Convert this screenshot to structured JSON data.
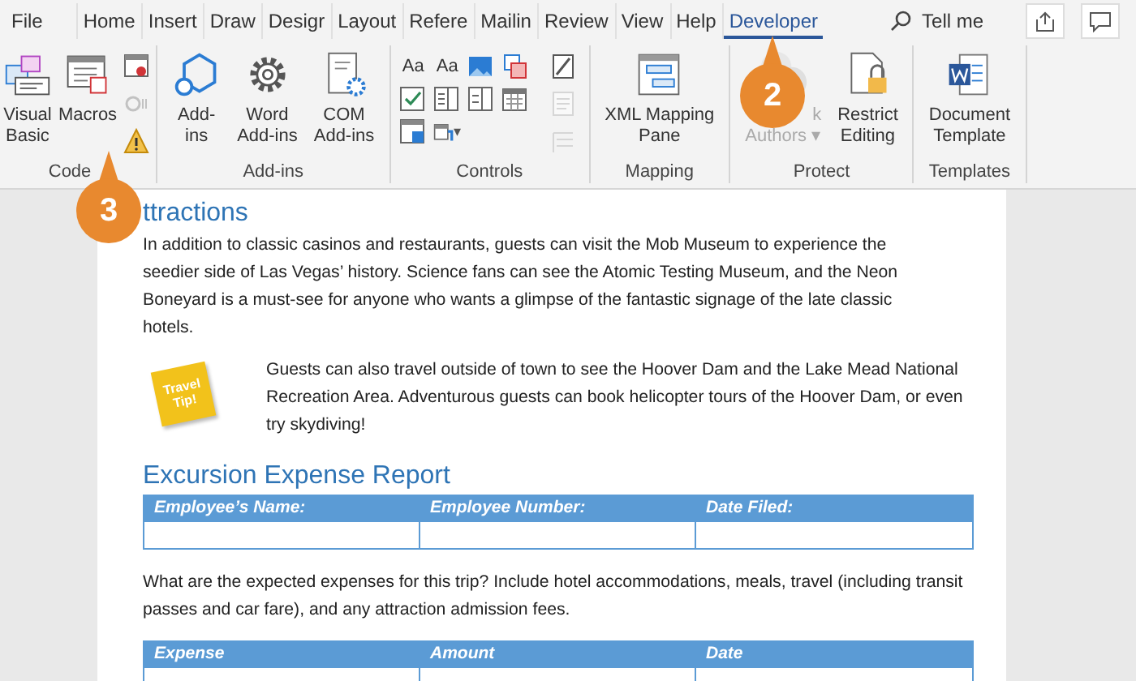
{
  "tabs": [
    {
      "label": "File",
      "selected": false
    },
    {
      "label": "Home",
      "selected": false
    },
    {
      "label": "Insert",
      "selected": false
    },
    {
      "label": "Draw",
      "selected": false
    },
    {
      "label": "Desigr",
      "selected": false
    },
    {
      "label": "Layout",
      "selected": false
    },
    {
      "label": "Refere",
      "selected": false
    },
    {
      "label": "Mailin",
      "selected": false
    },
    {
      "label": "Review",
      "selected": false
    },
    {
      "label": "View",
      "selected": false
    },
    {
      "label": "Help",
      "selected": false
    },
    {
      "label": "Developer",
      "selected": true
    }
  ],
  "tell_me": "Tell me",
  "ribbon": {
    "groups": [
      {
        "label": "Code",
        "kind": "code",
        "large": [
          {
            "lines": [
              "Visual",
              "Basic"
            ],
            "disabled": false
          },
          {
            "lines": [
              "Macros"
            ],
            "disabled": false
          }
        ],
        "small": [
          {
            "disabled": false
          },
          {
            "disabled": true
          },
          {
            "disabled": false
          }
        ]
      },
      {
        "label": "Add-ins",
        "kind": "plain",
        "large": [
          {
            "lines": [
              "Add-",
              "ins"
            ],
            "disabled": false
          },
          {
            "lines": [
              "Word",
              "Add-ins"
            ],
            "disabled": false
          },
          {
            "lines": [
              "COM",
              "Add-ins"
            ],
            "disabled": false
          }
        ]
      },
      {
        "label": "Controls",
        "kind": "controls",
        "grid": [
          {
            "glyph": "Aa",
            "disabled": false
          },
          {
            "glyph": "Aa",
            "disabled": false
          },
          {
            "disabled": false
          },
          {
            "disabled": false
          },
          {
            "disabled": false
          },
          {
            "disabled": false
          },
          {
            "disabled": false
          },
          {
            "disabled": false
          },
          {
            "disabled": false
          },
          {
            "disabled": false,
            "dropdown": "▾"
          }
        ],
        "small": [
          {
            "disabled": false
          },
          {
            "disabled": true
          },
          {
            "disabled": true
          }
        ]
      },
      {
        "label": "Mapping",
        "kind": "plain",
        "large": [
          {
            "lines": [
              "XML Mapping",
              "Pane"
            ],
            "disabled": false
          }
        ]
      },
      {
        "label": "Protect",
        "kind": "plain",
        "large": [
          {
            "lines": [
              "k",
              "Authors ▾"
            ],
            "disabled": true
          },
          {
            "lines": [
              "Restrict",
              "Editing"
            ],
            "disabled": false
          }
        ]
      },
      {
        "label": "Templates",
        "kind": "plain",
        "large": [
          {
            "lines": [
              "Document",
              "Template"
            ],
            "disabled": false
          }
        ]
      }
    ]
  },
  "callouts": [
    {
      "number": "2",
      "kind": "up"
    },
    {
      "number": "3",
      "kind": "up"
    }
  ],
  "document": {
    "heading": "ttractions",
    "paragraph": "In addition to classic casinos and restaurants, guests can visit the Mob Museum to experience the seedier side of Las Vegas’ history. Science fans can see the Atomic Testing Museum, and the Neon Boneyard is a must-see for anyone who wants a glimpse of the fantastic signage of the late classic hotels.",
    "tip": {
      "note": "Travel Tip!",
      "text": "Guests can also travel outside of town to see the Hoover Dam and the Lake Mead National Recreation Area. Adventurous guests can book helicopter tours of the Hoover Dam, or even try skydiving!"
    },
    "heading2": "Excursion Expense Report",
    "table1": {
      "columns": [
        "Employee’s Name:",
        "Employee Number:",
        "Date Filed:"
      ]
    },
    "paragraph2": "What are the expected expenses for this trip? Include hotel accommodations, meals, travel (including transit passes and car fare), and any attraction admission fees.",
    "table2": {
      "columns": [
        "Expense",
        "Amount",
        "Date"
      ]
    }
  }
}
